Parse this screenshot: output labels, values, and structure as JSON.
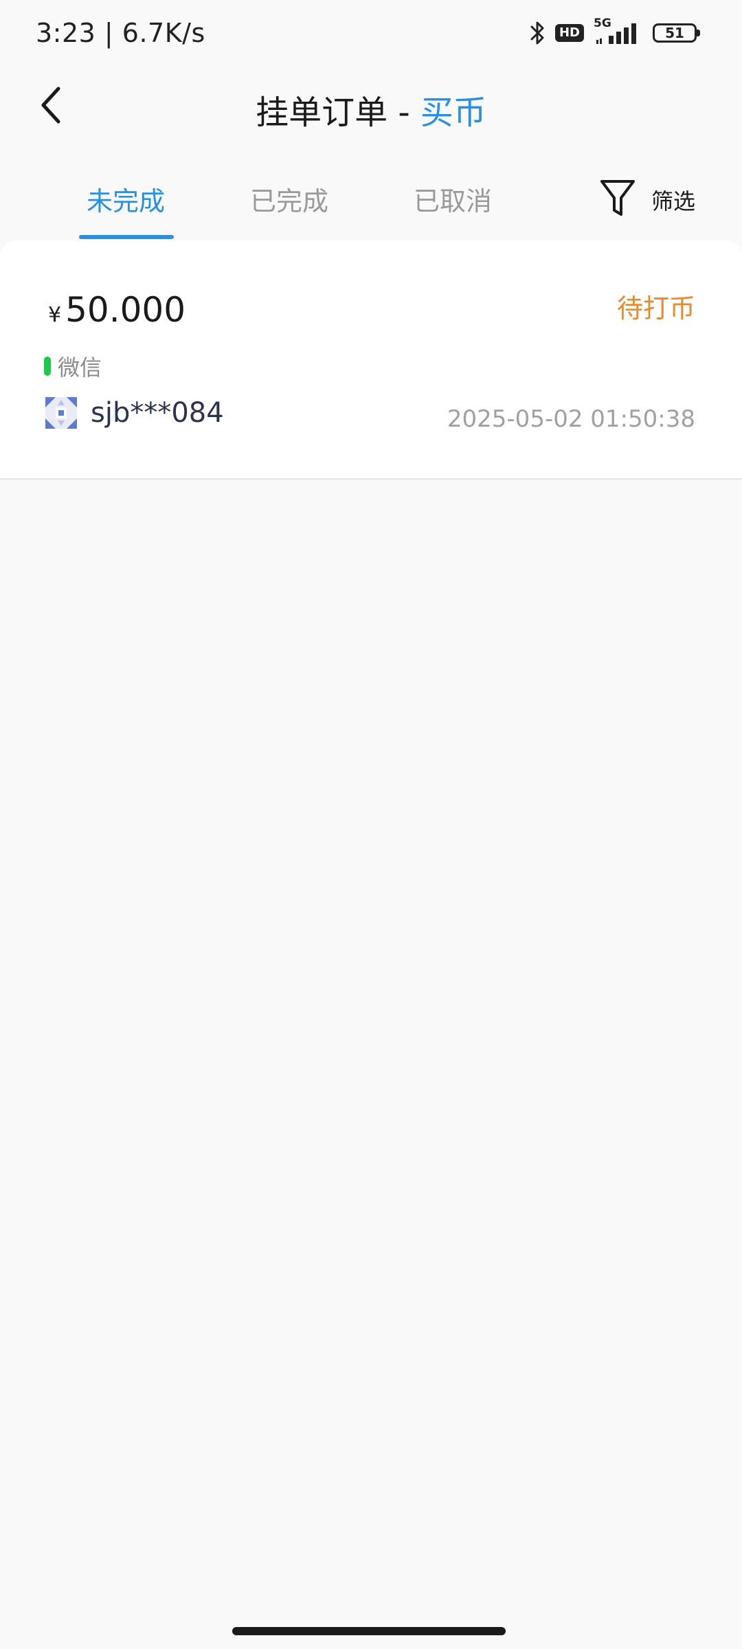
{
  "status_bar": {
    "time_speed": "3:23 | 6.7K/s",
    "icons": [
      "bluetooth-icon",
      "hd-badge",
      "signal-5g-icon",
      "battery-icon"
    ],
    "hd_label": "HD",
    "network_label": "5G",
    "battery_level": "51"
  },
  "header": {
    "back_icon": "chevron-left-icon",
    "title_main": "挂单订单 - ",
    "title_accent": "买币"
  },
  "tabs": [
    {
      "label": "未完成",
      "active": true
    },
    {
      "label": "已完成",
      "active": false
    },
    {
      "label": "已取消",
      "active": false
    }
  ],
  "filter": {
    "icon": "filter-icon",
    "label": "筛选"
  },
  "orders": [
    {
      "currency_symbol": "¥",
      "amount": "50.000",
      "status": "待打币",
      "payment_method": "微信",
      "username": "sjb***084",
      "datetime": "2025-05-02 01:50:38"
    }
  ],
  "colors": {
    "accent": "#2a8fe0",
    "status_pending": "#e68a2e",
    "payment_wechat": "#1ec84a",
    "background": "#f9f9f9",
    "muted_text": "#a0a0a0"
  }
}
